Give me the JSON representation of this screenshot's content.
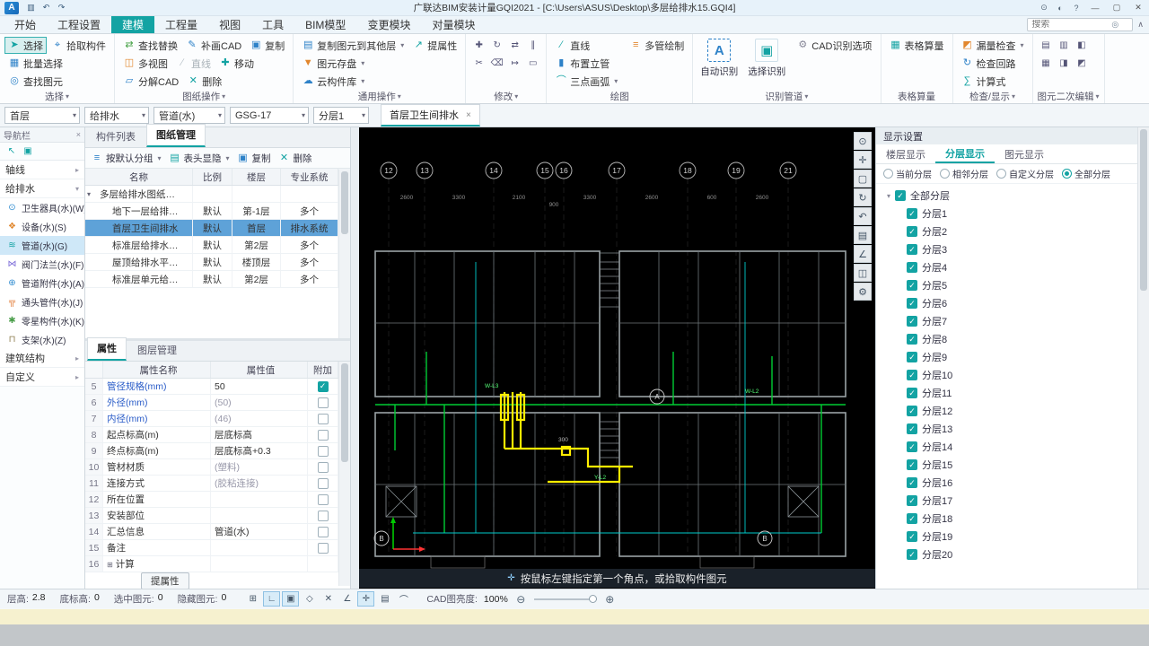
{
  "titlebar": {
    "title": "广联达BIM安装计量GQI2021 - [C:\\Users\\ASUS\\Desktop\\多层给排水15.GQI4]",
    "logo_letter": "A",
    "qa_icons": [
      {
        "name": "save-icon",
        "glyph": "▥"
      },
      {
        "name": "undo-icon",
        "glyph": "↶"
      },
      {
        "name": "redo-icon",
        "glyph": "↷"
      }
    ],
    "right_icons": [
      {
        "name": "account-icon",
        "glyph": "⊙"
      },
      {
        "name": "skin-icon",
        "glyph": "◐"
      },
      {
        "name": "help-icon",
        "glyph": "?"
      }
    ],
    "window_buttons": [
      {
        "name": "minimize-button",
        "glyph": "—"
      },
      {
        "name": "maximize-button",
        "glyph": "▢"
      },
      {
        "name": "close-button",
        "glyph": "✕"
      }
    ]
  },
  "tabs": [
    {
      "label": "开始",
      "name": "tab-start"
    },
    {
      "label": "工程设置",
      "name": "tab-project-settings"
    },
    {
      "label": "建模",
      "name": "tab-modeling",
      "active": true
    },
    {
      "label": "工程量",
      "name": "tab-quantities"
    },
    {
      "label": "视图",
      "name": "tab-view"
    },
    {
      "label": "工具",
      "name": "tab-tools"
    },
    {
      "label": "BIM模型",
      "name": "tab-bim-model"
    },
    {
      "label": "变更模块",
      "name": "tab-change-module"
    },
    {
      "label": "对量模块",
      "name": "tab-compare-module"
    }
  ],
  "search": {
    "placeholder": "搜索",
    "icon": "◎",
    "collapse_icon": "∧"
  },
  "ribbon": {
    "groups": {
      "select": "选择",
      "sheet": "图纸操作",
      "common": "通用操作",
      "modify": "修改",
      "draw": "绘图",
      "identify": "识别管道",
      "table": "表格算量",
      "check": "检查/显示",
      "edit2": "图元二次编辑"
    },
    "buttons": {
      "select": "选择",
      "pick": "拾取构件",
      "batch_select": "批量选择",
      "find_element": "查找图元",
      "find_replace": "查找替换",
      "patch_cad": "补画CAD",
      "copy": "复制",
      "multi_view": "多视图",
      "line2": "直线",
      "move": "移动",
      "explode_cad": "分解CAD",
      "delete": "删除",
      "copy_to_floor": "复制图元到其他层",
      "extract_props": "提属性",
      "save_element": "图元存盘",
      "cloud_lib": "云构件库",
      "line": "直线",
      "riser": "布置立管",
      "arc3": "三点画弧",
      "multi_pipe": "多管绘制",
      "auto_identify": "自动识别",
      "select_identify": "选择识别",
      "cad_options": "CAD识别选项",
      "table_calc": "表格算量",
      "leak_check": "漏量检查",
      "loop_check": "检查回路",
      "calc_expr": "计算式"
    },
    "icons": {
      "select": "➤",
      "pick": "⌖",
      "batch": "▦",
      "find": "◎",
      "find_replace": "⇄",
      "patch": "✎",
      "copy": "▣",
      "multi_view": "◫",
      "line2": "∕",
      "move": "✚",
      "explode": "▱",
      "delete": "✕",
      "copy_to_floor": "▤",
      "extract": "↗",
      "save_element": "▼",
      "cloud": "☁",
      "line": "∕",
      "riser": "▮",
      "arc3": "⌒",
      "multi_pipe": "≡",
      "auto": "A",
      "select_identify": "▣",
      "cad_options": "⚙",
      "table": "▦",
      "leak": "◩",
      "loop": "↻",
      "calc": "∑"
    },
    "modify_icons": [
      {
        "name": "move-icon",
        "glyph": "✚"
      },
      {
        "name": "rotate-icon",
        "glyph": "↻"
      },
      {
        "name": "mirror-icon",
        "glyph": "⇄"
      },
      {
        "name": "offset-icon",
        "glyph": "∥"
      },
      {
        "name": "trim-icon",
        "glyph": "✂"
      },
      {
        "name": "erase-icon",
        "glyph": "⌫"
      },
      {
        "name": "extend-icon",
        "glyph": "↦"
      },
      {
        "name": "break-icon",
        "glyph": "▭"
      }
    ],
    "edit2_icons": [
      {
        "name": "merge-icon",
        "glyph": "▤"
      },
      {
        "name": "split-icon",
        "glyph": "▥"
      },
      {
        "name": "align-icon",
        "glyph": "◧"
      },
      {
        "name": "array-icon",
        "glyph": "▦"
      },
      {
        "name": "elevation-icon",
        "glyph": "◨"
      },
      {
        "name": "swap-icon",
        "glyph": "◩"
      }
    ]
  },
  "context_toolbar": {
    "floor": "首层",
    "specialty": "给排水",
    "component": "管道(水)",
    "size": "GSG-17",
    "layer": "分层1",
    "doc_tab": "首层卫生间排水",
    "close_glyph": "×"
  },
  "nav": {
    "title": "导航栏",
    "close_glyph": "×",
    "tool_icons": [
      {
        "name": "dock-icon",
        "glyph": "↖"
      },
      {
        "name": "panel-icon",
        "glyph": "▣"
      }
    ],
    "sections": {
      "axis": "轴线",
      "water": "给排水",
      "structure": "建筑结构",
      "custom": "自定义"
    },
    "items": [
      {
        "label": "卫生器具(水)(W)",
        "icon": "⊙",
        "name": "nav-item-sanitary-fixture"
      },
      {
        "label": "设备(水)(S)",
        "icon": "❖",
        "name": "nav-item-equipment"
      },
      {
        "label": "管道(水)(G)",
        "icon": "≋",
        "name": "nav-item-pipe",
        "active": true
      },
      {
        "label": "阀门法兰(水)(F)",
        "icon": "⋈",
        "name": "nav-item-valve-flange"
      },
      {
        "label": "管道附件(水)(A)",
        "icon": "⊕",
        "name": "nav-item-pipe-accessory"
      },
      {
        "label": "通头管件(水)(J)",
        "icon": "╦",
        "name": "nav-item-pipe-fitting"
      },
      {
        "label": "零星构件(水)(K)",
        "icon": "✱",
        "name": "nav-item-misc-component"
      },
      {
        "label": "支架(水)(Z)",
        "icon": "⊓",
        "name": "nav-item-support"
      }
    ]
  },
  "sheets": {
    "tab_components": "构件列表",
    "tab_sheets": "图纸管理",
    "toolbar": {
      "group_btn": "按默认分组",
      "header_btn": "表头显隐",
      "copy_btn": "复制",
      "delete_btn": "删除"
    },
    "columns": [
      "名称",
      "比例",
      "楼层",
      "专业系统"
    ],
    "rows": [
      {
        "name": "多层给排水图纸…",
        "scale": "",
        "floor": "",
        "system": "",
        "parent": true
      },
      {
        "name": "地下一层给排…",
        "scale": "默认",
        "floor": "第-1层",
        "system": "多个"
      },
      {
        "name": "首层卫生间排水",
        "scale": "默认",
        "floor": "首层",
        "system": "排水系统",
        "selected": true
      },
      {
        "name": "标准层给排水…",
        "scale": "默认",
        "floor": "第2层",
        "system": "多个"
      },
      {
        "name": "屋顶给排水平…",
        "scale": "默认",
        "floor": "楼顶层",
        "system": "多个"
      },
      {
        "name": "标准层单元给…",
        "scale": "默认",
        "floor": "第2层",
        "system": "多个"
      }
    ]
  },
  "props": {
    "tab_props": "属性",
    "tab_layers": "图层管理",
    "columns": [
      "属性名称",
      "属性值",
      "附加"
    ],
    "rows": [
      {
        "num": "5",
        "name": "管径规格(mm)",
        "value": "50",
        "checked": true,
        "blue": true
      },
      {
        "num": "6",
        "name": "外径(mm)",
        "value": "(50)",
        "blue": true,
        "gray": true
      },
      {
        "num": "7",
        "name": "内径(mm)",
        "value": "(46)",
        "blue": true,
        "gray": true
      },
      {
        "num": "8",
        "name": "起点标高(m)",
        "value": "层底标高"
      },
      {
        "num": "9",
        "name": "终点标高(m)",
        "value": "层底标高+0.3"
      },
      {
        "num": "10",
        "name": "管材材质",
        "value": "(塑料)",
        "gray": true
      },
      {
        "num": "11",
        "name": "连接方式",
        "value": "(胶粘连接)",
        "gray": true
      },
      {
        "num": "12",
        "name": "所在位置",
        "value": ""
      },
      {
        "num": "13",
        "name": "安装部位",
        "value": ""
      },
      {
        "num": "14",
        "name": "汇总信息",
        "value": "管道(水)"
      },
      {
        "num": "15",
        "name": "备注",
        "value": ""
      },
      {
        "num": "16",
        "name": "计算",
        "value": "",
        "expand": true
      }
    ],
    "extract_btn": "提属性"
  },
  "cad": {
    "grid_labels": [
      "12",
      "13",
      "14",
      "15",
      "16",
      "17",
      "18",
      "19",
      "21"
    ],
    "dim_labels": [
      "2600",
      "3300",
      "2100",
      "900",
      "3300",
      "2600",
      "600",
      "2600"
    ],
    "pipe_labels": [
      "W-L3",
      "Y-L2",
      "W-L2"
    ],
    "extra_dim": "300",
    "marker_a": "A",
    "marker_b": "B",
    "hint": "按鼠标左键指定第一个角点，或拾取构件图元",
    "hint_icon": "✛",
    "tools": [
      {
        "name": "zoom-icon",
        "glyph": "⊙"
      },
      {
        "name": "pan-icon",
        "glyph": "✛"
      },
      {
        "name": "fit-view-icon",
        "glyph": "▢"
      },
      {
        "name": "rotate-view-icon",
        "glyph": "↻"
      },
      {
        "name": "previous-view-icon",
        "glyph": "↶"
      },
      {
        "name": "layers-icon",
        "glyph": "▤"
      },
      {
        "name": "measure-icon",
        "glyph": "∠"
      },
      {
        "name": "snapshot-icon",
        "glyph": "◫"
      },
      {
        "name": "view-settings-icon",
        "glyph": "⚙"
      }
    ]
  },
  "display": {
    "title": "显示设置",
    "tabs": [
      {
        "label": "楼层显示",
        "name": "tab-floor-display"
      },
      {
        "label": "分层显示",
        "name": "tab-layer-display",
        "active": true
      },
      {
        "label": "图元显示",
        "name": "tab-element-display"
      }
    ],
    "radios": [
      {
        "label": "当前分层",
        "name": "radio-current-layer"
      },
      {
        "label": "相邻分层",
        "name": "radio-adjacent-layer"
      },
      {
        "label": "自定义分层",
        "name": "radio-custom-layer"
      },
      {
        "label": "全部分层",
        "name": "radio-all-layers",
        "selected": true
      }
    ],
    "root": "全部分层",
    "layers": [
      "分层1",
      "分层2",
      "分层3",
      "分层4",
      "分层5",
      "分层6",
      "分层7",
      "分层8",
      "分层9",
      "分层10",
      "分层11",
      "分层12",
      "分层13",
      "分层14",
      "分层15",
      "分层16",
      "分层17",
      "分层18",
      "分层19",
      "分层20"
    ]
  },
  "status": {
    "items": [
      {
        "label": "层高:",
        "value": "2.8"
      },
      {
        "label": "底标高:",
        "value": "0"
      },
      {
        "label": "选中图元:",
        "value": "0"
      },
      {
        "label": "隐藏图元:",
        "value": "0"
      }
    ],
    "tools": [
      {
        "name": "dynamic-input-icon",
        "glyph": "⊞"
      },
      {
        "name": "ortho-mode-icon",
        "glyph": "∟",
        "on": true
      },
      {
        "name": "rect-select-icon",
        "glyph": "▣",
        "on": true
      },
      {
        "name": "object-snap-icon",
        "glyph": "◇"
      },
      {
        "name": "cross-select-icon",
        "glyph": "✕"
      },
      {
        "name": "angle-snap-icon",
        "glyph": "∠"
      },
      {
        "name": "coords-input-icon",
        "glyph": "✛",
        "on": true
      },
      {
        "name": "image-quality-icon",
        "glyph": "▤"
      },
      {
        "name": "arc-mode-icon",
        "glyph": "⌒"
      }
    ],
    "brightness_label": "CAD图亮度:",
    "brightness_value": "100%",
    "minus_glyph": "⊖",
    "plus_glyph": "⊕"
  }
}
